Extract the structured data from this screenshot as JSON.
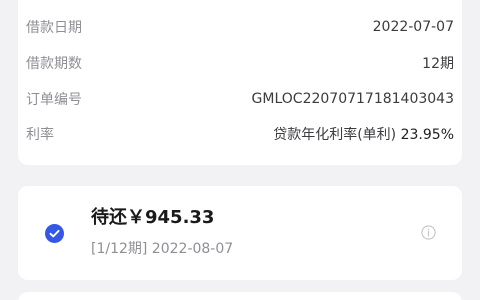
{
  "loan_details": {
    "date": {
      "label": "借款日期",
      "value": "2022-07-07"
    },
    "periods": {
      "label": "借款期数",
      "value": "12期"
    },
    "order": {
      "label": "订单编号",
      "value": "GMLOC22070717181403043"
    },
    "rate": {
      "label": "利率",
      "prefix": "贷款年化利率(单利)",
      "value": "23.95%"
    }
  },
  "repayment": {
    "amount": "待还￥945.33",
    "period": "[1/12期] 2022-08-07",
    "selected": true,
    "accent_color": "#3557e8"
  },
  "icons": {
    "check": "check-circle-icon",
    "info": "info-icon"
  }
}
